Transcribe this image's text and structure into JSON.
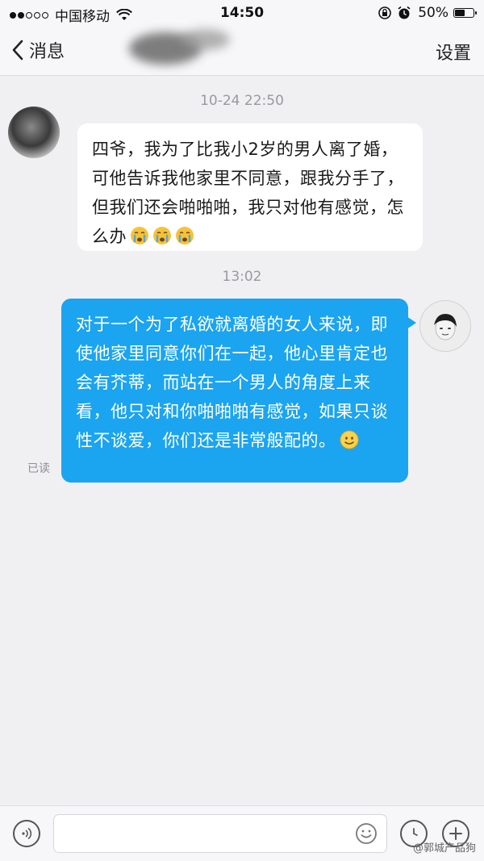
{
  "status_bar": {
    "carrier": "中国移动",
    "time": "14:50",
    "battery": "50%",
    "battery_level": 0.5,
    "signal_bars_filled": 2,
    "signal_bars_total": 5
  },
  "nav": {
    "back_label": "消息",
    "settings_label": "设置"
  },
  "messages": [
    {
      "direction": "incoming",
      "timestamp": "10-24 22:50",
      "text": "四爷，我为了比我小2岁的男人离了婚，可他告诉我他家里不同意，跟我分手了，但我们还会啪啪啪，我只对他有感觉，怎么办",
      "emojis": [
        "crying-emoji",
        "crying-emoji",
        "crying-emoji"
      ]
    },
    {
      "direction": "outgoing",
      "timestamp": "13:02",
      "text": "对于一个为了私欲就离婚的女人来说，即使他家里同意你们在一起，他心里肯定也会有芥蒂，而站在一个男人的角度上来看，他只对和你啪啪啪有感觉，如果只谈性不谈爱，你们还是非常般配的。",
      "emojis": [
        "smile-emoji"
      ],
      "read_status": "已读"
    }
  ],
  "input": {
    "placeholder": "",
    "value": ""
  },
  "watermark": "@郭城产品狗",
  "colors": {
    "outgoing_bubble": "#1ba4f0",
    "incoming_bubble": "#ffffff",
    "background": "#f0f0f3"
  }
}
